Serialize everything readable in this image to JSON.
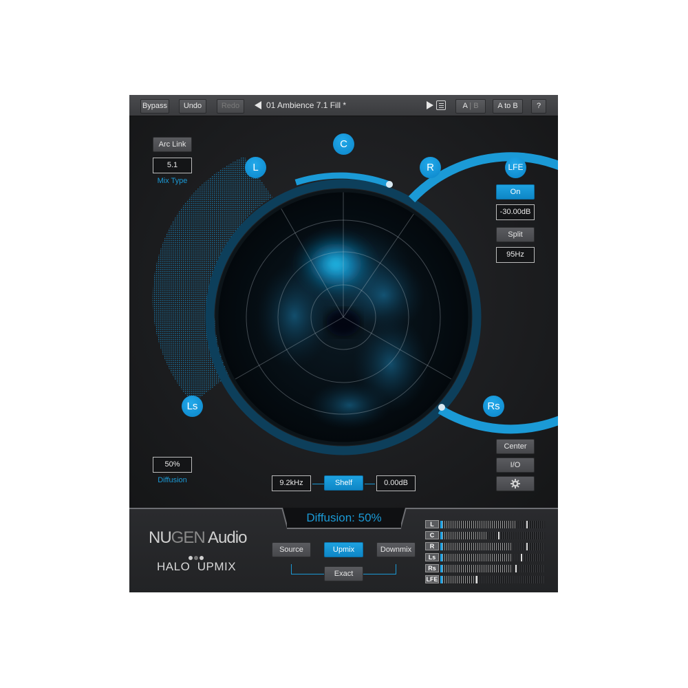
{
  "toolbar": {
    "bypass": "Bypass",
    "undo": "Undo",
    "redo": "Redo",
    "preset": "01 Ambience 7.1 Fill *",
    "ab_a": "A",
    "ab_sep": "|",
    "ab_b": "B",
    "a_to_b": "A to B",
    "help": "?"
  },
  "left_panel": {
    "arc_link": "Arc Link",
    "mix_type_value": "5.1",
    "mix_type_label": "Mix Type",
    "diffusion_value": "50%",
    "diffusion_label": "Diffusion"
  },
  "speakers": {
    "c": "C",
    "l": "L",
    "r": "R",
    "ls": "Ls",
    "rs": "Rs",
    "lfe": "LFE"
  },
  "lfe_panel": {
    "on": "On",
    "gain": "-30.00dB",
    "split": "Split",
    "freq": "95Hz"
  },
  "shelf": {
    "freq": "9.2kHz",
    "button": "Shelf",
    "gain": "0.00dB"
  },
  "right_buttons": {
    "center": "Center",
    "io": "I/O",
    "settings_icon": "gear-icon"
  },
  "bottom": {
    "diffusion_display": "Diffusion: 50%",
    "source": "Source",
    "upmix": "Upmix",
    "downmix": "Downmix",
    "exact": "Exact",
    "brand_nu": "NU",
    "brand_gen": "GEN",
    "brand_audio": " Audio",
    "product_halo": "HALO",
    "product_upmix": "UPMIX"
  },
  "meters": [
    {
      "label": "L",
      "level": 0.72,
      "peak": 0.82
    },
    {
      "label": "C",
      "level": 0.45,
      "peak": 0.55
    },
    {
      "label": "R",
      "level": 0.68,
      "peak": 0.82
    },
    {
      "label": "Ls",
      "level": 0.69,
      "peak": 0.77
    },
    {
      "label": "Rs",
      "level": 0.69,
      "peak": 0.72
    },
    {
      "label": "LFE",
      "level": 0.34,
      "peak": 0.34
    }
  ],
  "colors": {
    "accent": "#1b9ad6",
    "panel": "#1c1d1f",
    "button": "#505155"
  }
}
